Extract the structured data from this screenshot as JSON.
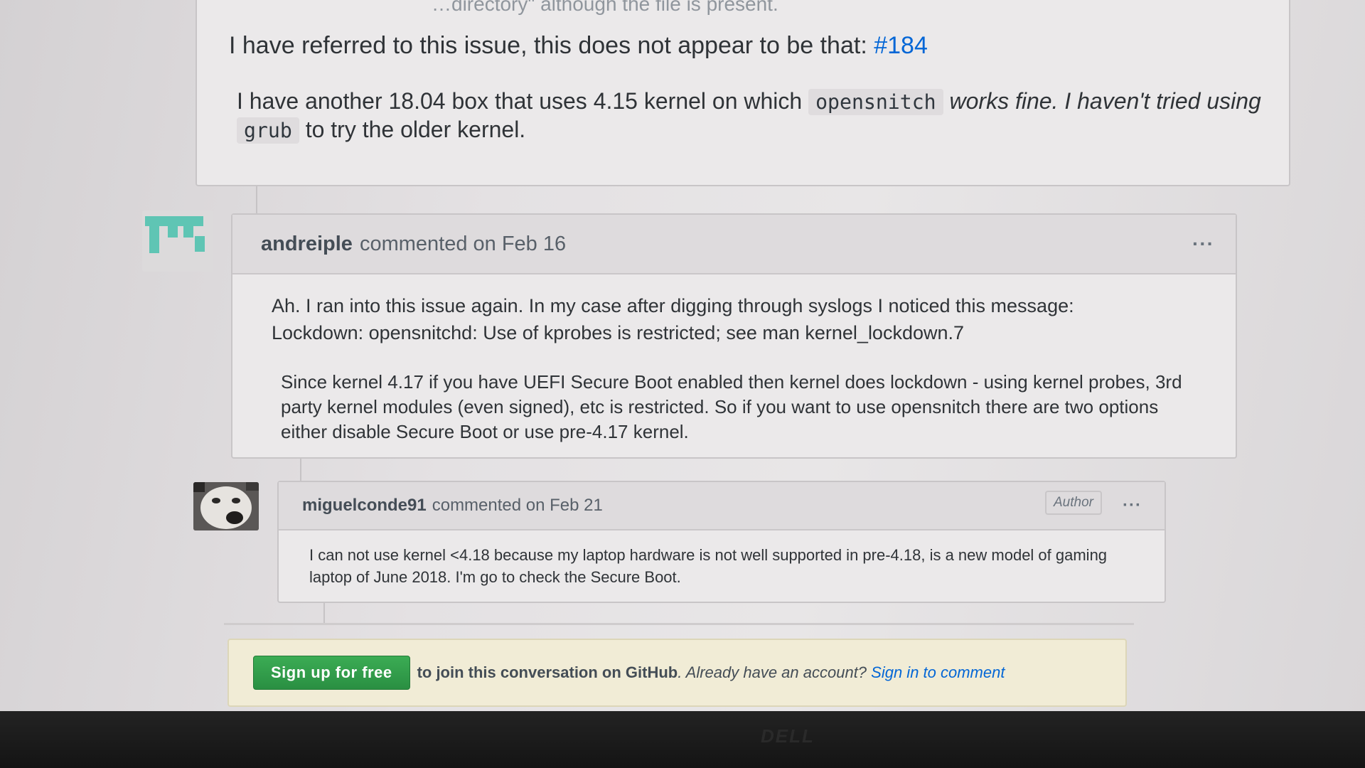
{
  "partial_top": {
    "text": "…directory\" although the file is present."
  },
  "comment1": {
    "p1_text": "I have referred to this issue, this does not appear to be that: ",
    "p1_link": "#184",
    "p2_pre": "I have another 18.04 box that uses 4.15 kernel on which ",
    "p2_code1": "opensnitch",
    "p2_mid": " works fine. I haven't tried using ",
    "p2_code2": "grub",
    "p2_post": " to try the older kernel."
  },
  "comment2": {
    "author": "andreiple",
    "meta": "commented on Feb 16",
    "more_label": "···",
    "p1_line1": "Ah. I ran into this issue again. In my case after digging through syslogs I noticed this message:",
    "p1_line2": "Lockdown: opensnitchd: Use of kprobes is restricted; see man kernel_lockdown.7",
    "p2": "Since kernel 4.17 if you have UEFI Secure Boot enabled then kernel does lockdown - using kernel probes, 3rd party kernel modules (even signed), etc is restricted. So if you want to use opensnitch there are two options either disable Secure Boot or use pre-4.17 kernel."
  },
  "comment3": {
    "author": "miguelconde91",
    "meta": "commented on Feb 21",
    "badge": "Author",
    "more_label": "···",
    "p1": "I can not use kernel <4.18 because my laptop hardware is not well supported in pre-4.18, is a new model of gaming laptop of June 2018. I'm go to check the Secure Boot."
  },
  "signup": {
    "button_label": "Sign up for free",
    "text_bold": "to join this conversation on GitHub",
    "text_rest": ". Already have an account? ",
    "signin_link": "Sign in to comment"
  },
  "monitor": {
    "brand": "DELL"
  },
  "colors": {
    "link": "#0366d6",
    "signup_green": "#2ea44f",
    "identicon": "#5fc5b4"
  }
}
